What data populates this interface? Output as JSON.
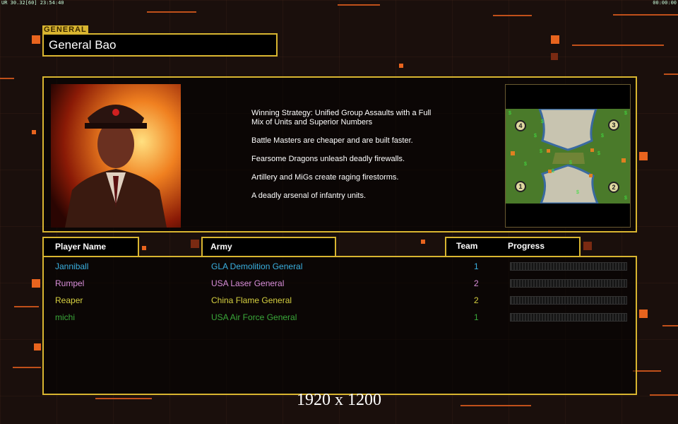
{
  "status": {
    "left": "UR 30.32[60] 23:54:40",
    "right": "00:00:00"
  },
  "section_label": "GENERAL",
  "general_name": "General Bao",
  "description": [
    "Winning Strategy: Unified Group Assaults with a Full\n Mix of Units and Superior Numbers",
    "Battle Masters are cheaper and are built faster.",
    "Fearsome Dragons unleash deadly firewalls.",
    "Artillery and MiGs create raging firestorms.",
    "A deadly arsenal of infantry units."
  ],
  "minimap": {
    "start_positions": [
      "1",
      "2",
      "3",
      "4"
    ]
  },
  "columns": {
    "player": "Player Name",
    "army": "Army",
    "team": "Team",
    "progress": "Progress"
  },
  "players": [
    {
      "name": "Janniball",
      "army": "GLA Demolition General",
      "team": "1",
      "color": "#3ab0e0",
      "progress": 0
    },
    {
      "name": "Rumpel",
      "army": "USA Laser General",
      "team": "2",
      "color": "#d98ed9",
      "progress": 0
    },
    {
      "name": "Reaper",
      "army": "China Flame General",
      "team": "2",
      "color": "#d6d040",
      "progress": 0
    },
    {
      "name": "michi",
      "army": "USA Air Force General",
      "team": "1",
      "color": "#3aa83a",
      "progress": 0
    }
  ],
  "resolution_label": "1920 x 1200",
  "colors": {
    "accent": "#e8641e",
    "frame": "#d8b530"
  }
}
